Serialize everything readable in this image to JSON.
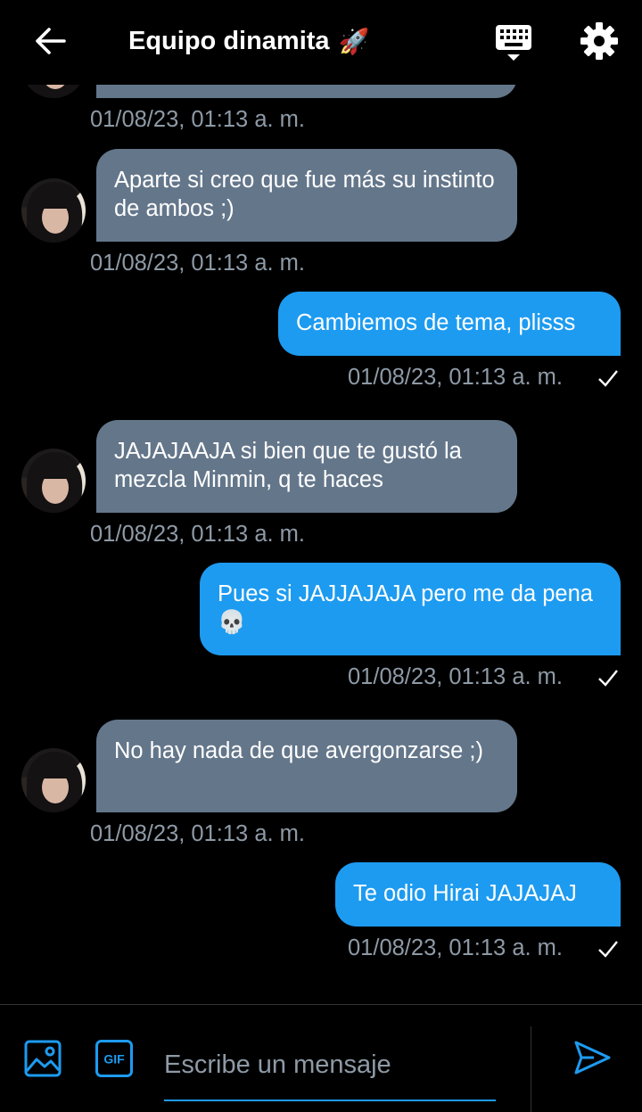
{
  "header": {
    "title": "Equipo dinamita",
    "title_emoji": "🚀"
  },
  "messages": [
    {
      "direction": "in",
      "text": "",
      "timestamp": "01/08/23, 01:13 a. m."
    },
    {
      "direction": "in",
      "text": "Aparte si creo que fue más su instinto de ambos ;)",
      "timestamp": "01/08/23, 01:13 a. m."
    },
    {
      "direction": "out",
      "text": "Cambiemos de tema, plisss",
      "timestamp": "01/08/23, 01:13 a. m.",
      "read": true
    },
    {
      "direction": "in",
      "text": "JAJAJAAJA si bien que te gustó la mezcla Minmin, q te haces",
      "timestamp": "01/08/23, 01:13 a. m."
    },
    {
      "direction": "out",
      "text": "Pues si JAJJAJAJA pero me da pena 💀",
      "timestamp": "01/08/23, 01:13 a. m.",
      "read": true
    },
    {
      "direction": "in",
      "text": "No hay nada de que avergonzarse ;)",
      "timestamp": "01/08/23, 01:13 a. m."
    },
    {
      "direction": "out",
      "text": "Te odio Hirai JAJAJAJ",
      "timestamp": "01/08/23, 01:13 a. m.",
      "read": true
    }
  ],
  "composer": {
    "placeholder": "Escribe un mensaje",
    "gif_label": "GIF"
  },
  "icons": {
    "back": "arrow-left-icon",
    "keyboard": "keyboard-icon",
    "settings": "gear-icon",
    "image": "image-icon",
    "gif": "gif-icon",
    "send": "send-icon",
    "read": "check-icon"
  },
  "colors": {
    "background": "#000000",
    "incoming_bubble": "#64768a",
    "outgoing_bubble": "#1d9bf0",
    "timestamp": "#8e9aa6",
    "accent": "#1d9bf0"
  }
}
